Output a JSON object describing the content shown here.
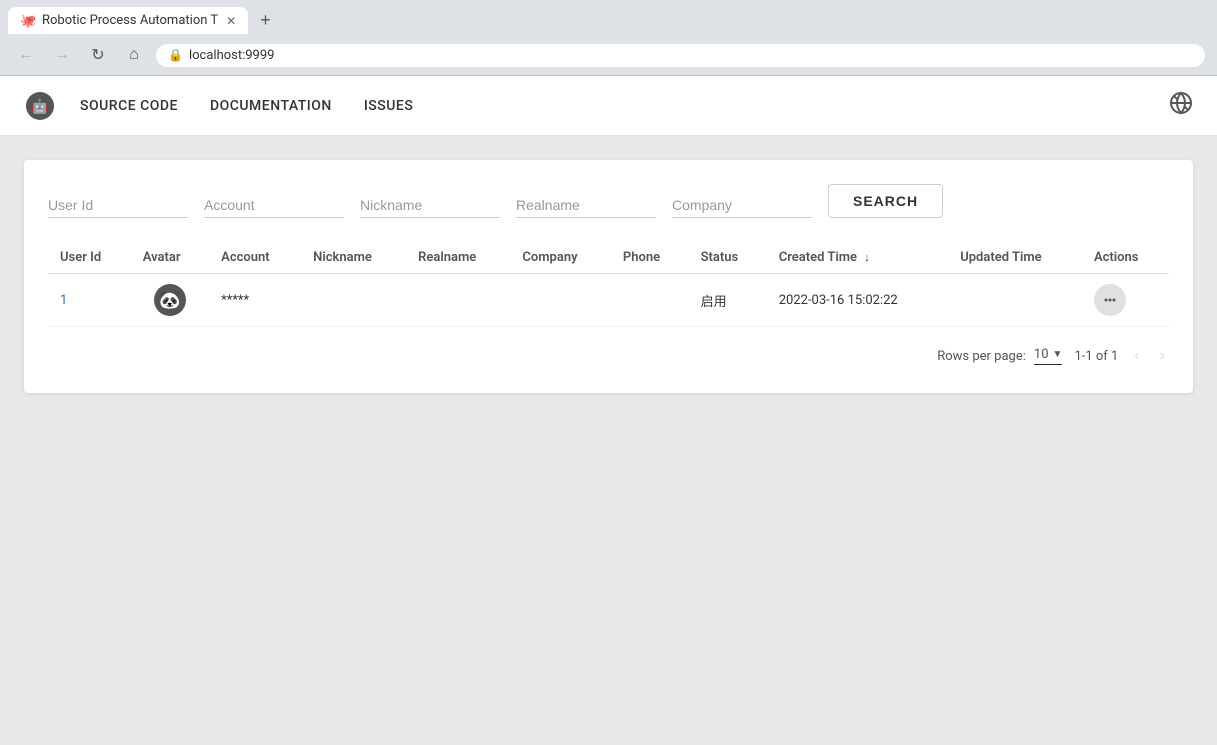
{
  "browser": {
    "tab_title": "Robotic Process Automation T",
    "tab_favicon": "🐙",
    "url": "localhost:9999",
    "new_tab_label": "+"
  },
  "nav_buttons": {
    "back": "←",
    "forward": "→",
    "reload": "↻",
    "home": "⌂",
    "lock": "🔒"
  },
  "header": {
    "nav_items": [
      {
        "label": "SOURCE CODE",
        "id": "source-code"
      },
      {
        "label": "DOCUMENTATION",
        "id": "documentation"
      },
      {
        "label": "ISSUES",
        "id": "issues"
      }
    ],
    "lang_icon": "A̧"
  },
  "search_form": {
    "fields": [
      {
        "id": "user-id",
        "placeholder": "User Id",
        "value": ""
      },
      {
        "id": "account",
        "placeholder": "Account",
        "value": ""
      },
      {
        "id": "nickname",
        "placeholder": "Nickname",
        "value": ""
      },
      {
        "id": "realname",
        "placeholder": "Realname",
        "value": ""
      },
      {
        "id": "company",
        "placeholder": "Company",
        "value": ""
      }
    ],
    "search_button": "SEARCH"
  },
  "table": {
    "columns": [
      {
        "label": "User Id",
        "key": "userId",
        "sortable": false
      },
      {
        "label": "Avatar",
        "key": "avatar",
        "sortable": false
      },
      {
        "label": "Account",
        "key": "account",
        "sortable": false
      },
      {
        "label": "Nickname",
        "key": "nickname",
        "sortable": false
      },
      {
        "label": "Realname",
        "key": "realname",
        "sortable": false
      },
      {
        "label": "Company",
        "key": "company",
        "sortable": false
      },
      {
        "label": "Phone",
        "key": "phone",
        "sortable": false
      },
      {
        "label": "Status",
        "key": "status",
        "sortable": false
      },
      {
        "label": "Created Time",
        "key": "createdTime",
        "sortable": true,
        "sortDir": "desc"
      },
      {
        "label": "Updated Time",
        "key": "updatedTime",
        "sortable": false
      },
      {
        "label": "Actions",
        "key": "actions",
        "sortable": false
      }
    ],
    "rows": [
      {
        "userId": "1",
        "avatar": "🐼",
        "account": "*****",
        "nickname": "",
        "realname": "",
        "company": "",
        "phone": "",
        "status": "启用",
        "createdTime": "2022-03-16 15:02:22",
        "updatedTime": ""
      }
    ]
  },
  "pagination": {
    "rows_per_page_label": "Rows per page:",
    "per_page": "10",
    "page_info": "1-1 of 1",
    "prev_icon": "‹",
    "next_icon": "›",
    "dropdown_icon": "▼"
  }
}
